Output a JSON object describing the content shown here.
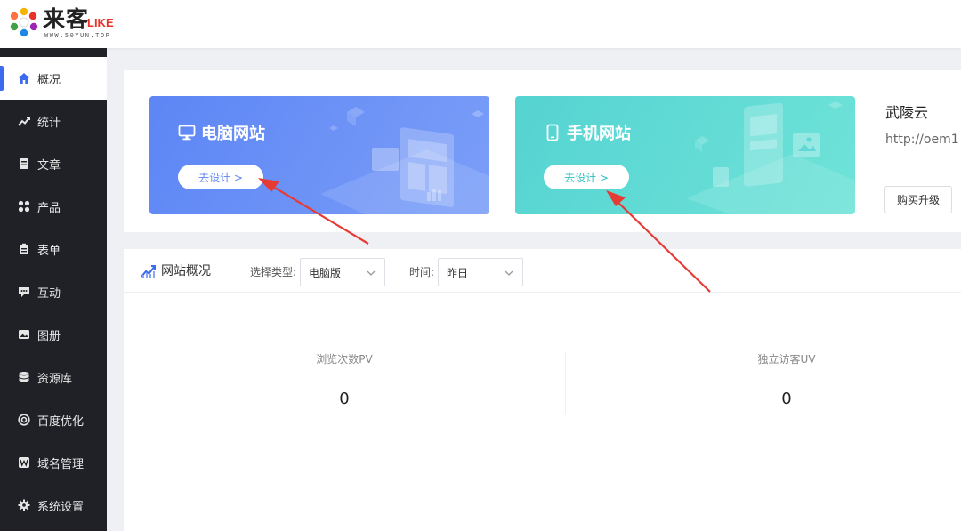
{
  "header": {
    "logo_text": "来客",
    "logo_like": "LIKE",
    "logo_sub": "WWW.50YUN.TOP"
  },
  "sidebar": {
    "items": [
      {
        "label": "概况",
        "icon": "home-icon",
        "active": true
      },
      {
        "label": "统计",
        "icon": "chart-icon"
      },
      {
        "label": "文章",
        "icon": "article-icon"
      },
      {
        "label": "产品",
        "icon": "grid-icon"
      },
      {
        "label": "表单",
        "icon": "form-icon"
      },
      {
        "label": "互动",
        "icon": "chat-icon"
      },
      {
        "label": "图册",
        "icon": "image-icon"
      },
      {
        "label": "资源库",
        "icon": "database-icon"
      },
      {
        "label": "百度优化",
        "icon": "target-icon"
      },
      {
        "label": "域名管理",
        "icon": "domain-icon"
      },
      {
        "label": "系统设置",
        "icon": "gear-icon"
      }
    ]
  },
  "banners": {
    "pc": {
      "title": "电脑网站",
      "button": "去设计 >"
    },
    "mobile": {
      "title": "手机网站",
      "button": "去设计 >"
    }
  },
  "site": {
    "name": "武陵云",
    "url": "http://oem1",
    "upgrade_button": "购买升级"
  },
  "overview": {
    "title": "网站概况",
    "type_label": "选择类型:",
    "type_value": "电脑版",
    "time_label": "时间:",
    "time_value": "昨日",
    "stats": [
      {
        "name": "浏览次数PV",
        "value": "0"
      },
      {
        "name": "独立访客UV",
        "value": "0"
      }
    ]
  },
  "colors": {
    "accent": "#3c6bf0",
    "sidebar_bg": "#1f2126",
    "pc_banner": "#6a91f6",
    "mobile_banner": "#5ddad5",
    "arrow": "#e63b34"
  }
}
